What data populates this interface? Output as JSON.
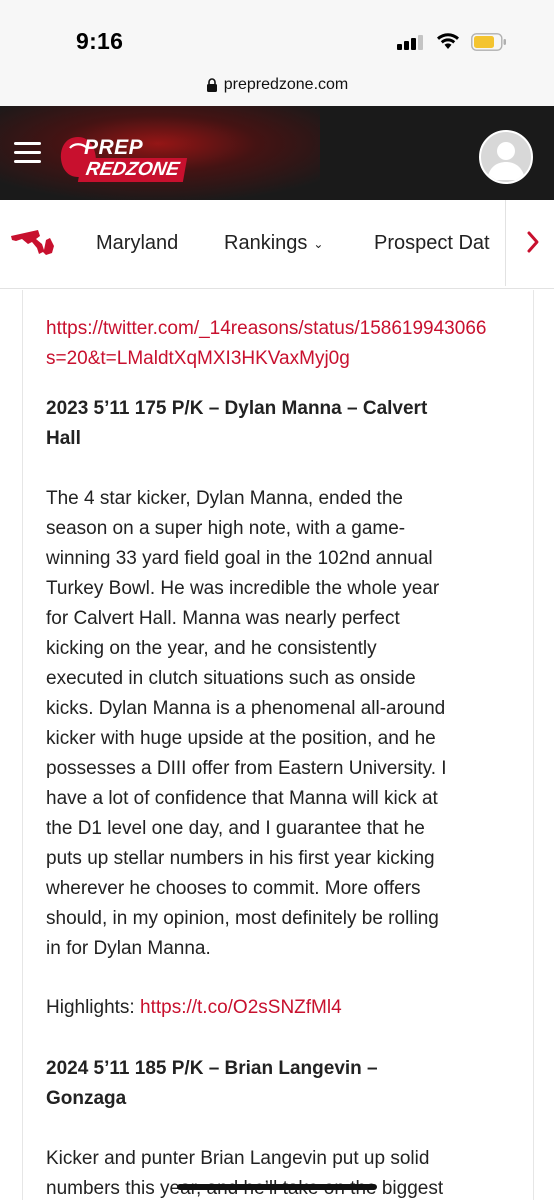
{
  "status_bar": {
    "time": "9:16"
  },
  "browser": {
    "url": "prepredzone.com"
  },
  "header": {
    "logo_line1": "PREP",
    "logo_line2": "REDZONE",
    "menu_icon": "hamburger-icon",
    "avatar_icon": "user-avatar-icon"
  },
  "nav": {
    "items": [
      {
        "label": "Maryland"
      },
      {
        "label": "Rankings"
      },
      {
        "label": "Prospect Dat"
      }
    ],
    "more_icon": "chevron-right-icon"
  },
  "article": {
    "top_link_line1": "https://twitter.com/_14reasons/status/158619943066",
    "top_link_line2": "s=20&t=LMaldtXqMXI3HKVaxMyj0g",
    "player1": {
      "heading_line1": "2023 5’11 175 P/K – Dylan Manna – Calvert",
      "heading_line2": "Hall",
      "body_lines": [
        "The 4 star kicker, Dylan Manna, ended the",
        "season on a super high note, with a game-",
        "winning 33 yard field goal in the 102nd annual",
        "Turkey Bowl. He was incredible the whole year",
        "for Calvert Hall. Manna was nearly perfect",
        "kicking on the year, and he consistently",
        "executed in clutch situations such as onside",
        "kicks. Dylan Manna is a phenomenal all-around",
        "kicker with huge upside at the position, and he",
        "possesses a DIII offer from Eastern University. I",
        "have a lot of confidence that Manna will kick at",
        "the D1 level one day, and I guarantee that he",
        "puts up stellar numbers in his first year kicking",
        "wherever he chooses to commit. More offers",
        "should, in my opinion, most definitely be rolling",
        "in for Dylan Manna."
      ],
      "highlights_label": "Highlights:",
      "highlights_link": "https://t.co/O2sSNZfMl4"
    },
    "player2": {
      "heading_line1": "2024 5’11 185 P/K – Brian Langevin –",
      "heading_line2": "Gonzaga",
      "body_line1": "Kicker and punter Brian Langevin put up solid",
      "body_line2": "numbers this year, and he’ll take on the biggest"
    }
  },
  "colors": {
    "accent_red": "#c8102e",
    "header_bg": "#1a1a1a"
  }
}
